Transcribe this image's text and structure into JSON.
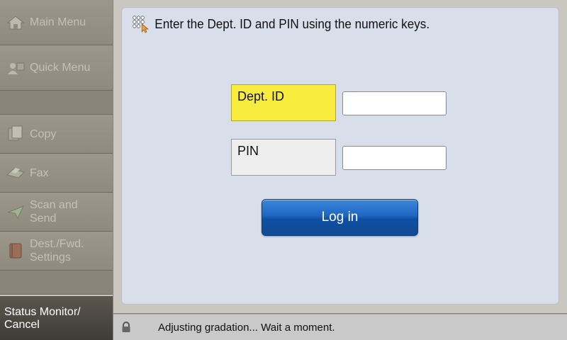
{
  "sidebar": {
    "items": [
      {
        "label": "Main Menu",
        "icon": "home-icon"
      },
      {
        "label": "Quick Menu",
        "icon": "users-icon"
      },
      {
        "label": "Copy",
        "icon": "copy-icon"
      },
      {
        "label": "Fax",
        "icon": "fax-icon"
      },
      {
        "label": "Scan and\nSend",
        "icon": "paper-plane-icon"
      },
      {
        "label": "Dest./Fwd.\nSettings",
        "icon": "book-icon"
      }
    ],
    "status_monitor_label": "Status Monitor/\nCancel"
  },
  "panel": {
    "instruction": "Enter the Dept. ID and PIN using the numeric keys.",
    "dept_id_label": "Dept. ID",
    "dept_id_value": "",
    "pin_label": "PIN",
    "pin_value": "",
    "login_label": "Log in"
  },
  "statusbar": {
    "message": "Adjusting gradation... Wait a moment.",
    "icon": "lock-icon"
  },
  "colors": {
    "sidebar_bg": "#8e897d",
    "panel_bg": "#d9dfea",
    "dept_label_highlight": "#f8ec3e",
    "login_button": "#1f66c2"
  }
}
